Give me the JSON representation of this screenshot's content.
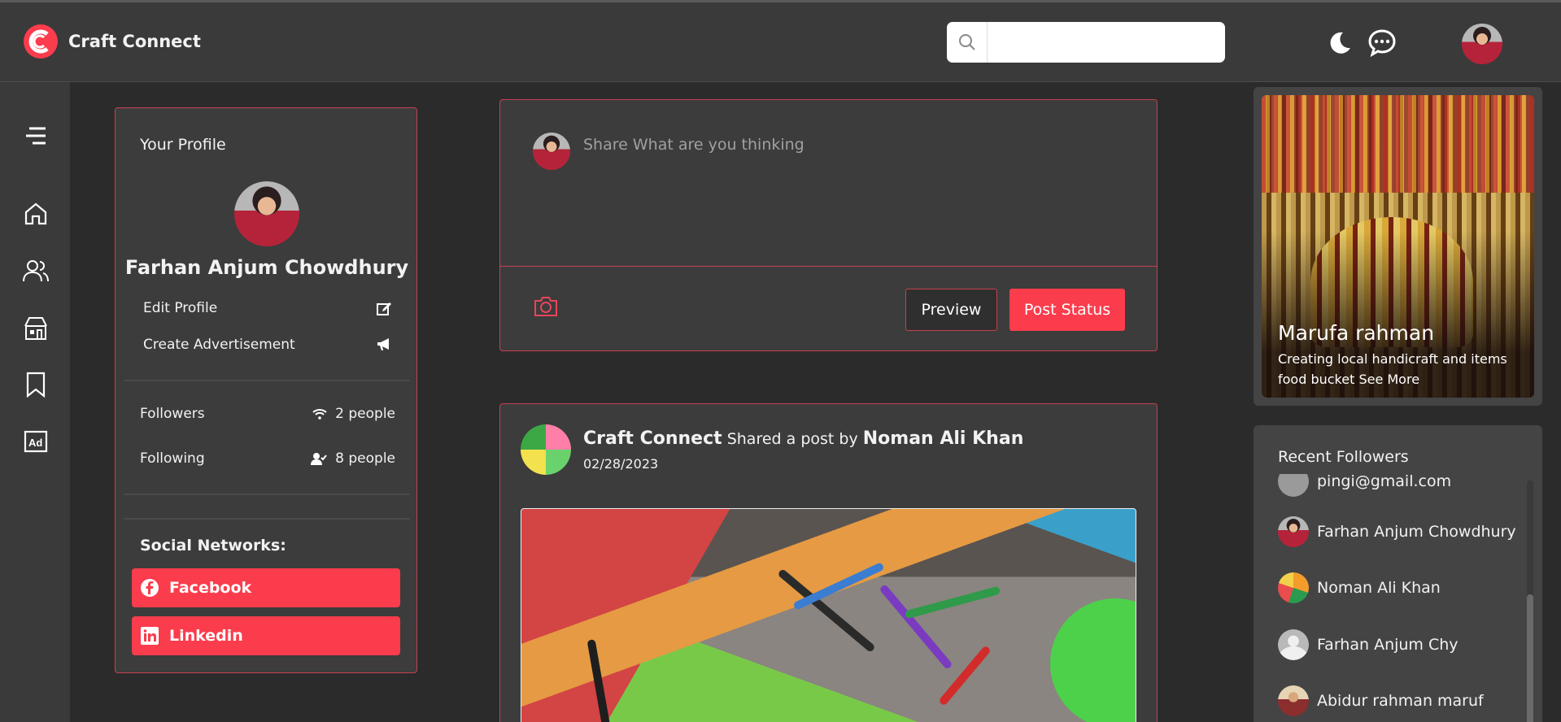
{
  "header": {
    "brand_name": "Craft Connect",
    "search_placeholder": ""
  },
  "profile": {
    "title": "Your Profile",
    "name": "Farhan Anjum Chowdhury",
    "edit_label": "Edit Profile",
    "advert_label": "Create Advertisement",
    "followers_label": "Followers",
    "followers_value": "2 people",
    "following_label": "Following",
    "following_value": "8 people",
    "social_title": "Social Networks:",
    "facebook_label": "Facebook",
    "linkedin_label": "Linkedin"
  },
  "composer": {
    "placeholder": "Share What are you thinking",
    "preview_label": "Preview",
    "post_label": "Post Status"
  },
  "post": {
    "author": "Craft Connect",
    "shared_text": "Shared a post by",
    "original_author": "Noman Ali Khan",
    "date": "02/28/2023"
  },
  "promo": {
    "name": "Marufa rahman",
    "description": "Creating local handicraft and items food bucket See More"
  },
  "recent_followers": {
    "title": "Recent Followers",
    "items": [
      {
        "name": "pingi@gmail.com"
      },
      {
        "name": "Farhan Anjum Chowdhury"
      },
      {
        "name": "Noman Ali Khan"
      },
      {
        "name": "Farhan Anjum Chy"
      },
      {
        "name": "Abidur rahman maruf"
      }
    ]
  },
  "colors": {
    "accent": "#fb3c4c",
    "card_border": "#c7414f",
    "background": "#2b2b2b",
    "panel": "#3a3a3a"
  },
  "icons": {
    "nav": [
      "menu-icon",
      "home-icon",
      "users-icon",
      "shop-icon",
      "bookmark-icon",
      "ad-icon"
    ],
    "top": [
      "moon-icon",
      "chat-icon"
    ]
  }
}
